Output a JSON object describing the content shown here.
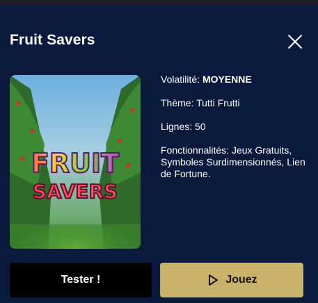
{
  "game": {
    "title": "Fruit Savers",
    "logo_text_line1": "FRUIT",
    "logo_text_line2": "SAVERS"
  },
  "details": {
    "volatility_label": "Volatilité:",
    "volatility_value": "MOYENNE",
    "theme": "Thème: Tutti Frutti",
    "lines": "Lignes: 50",
    "features": "Fonctionnalités: Jeux Gratuits, Symboles Surdimensionnés, Lien de Fortune."
  },
  "actions": {
    "test_label": "Tester !",
    "play_label": "Jouez",
    "play_icon": "play-icon"
  },
  "icons": {
    "close": "close-icon"
  },
  "colors": {
    "background": "#0a1a3c",
    "play_button": "#c9b26a",
    "test_button": "#000000"
  }
}
